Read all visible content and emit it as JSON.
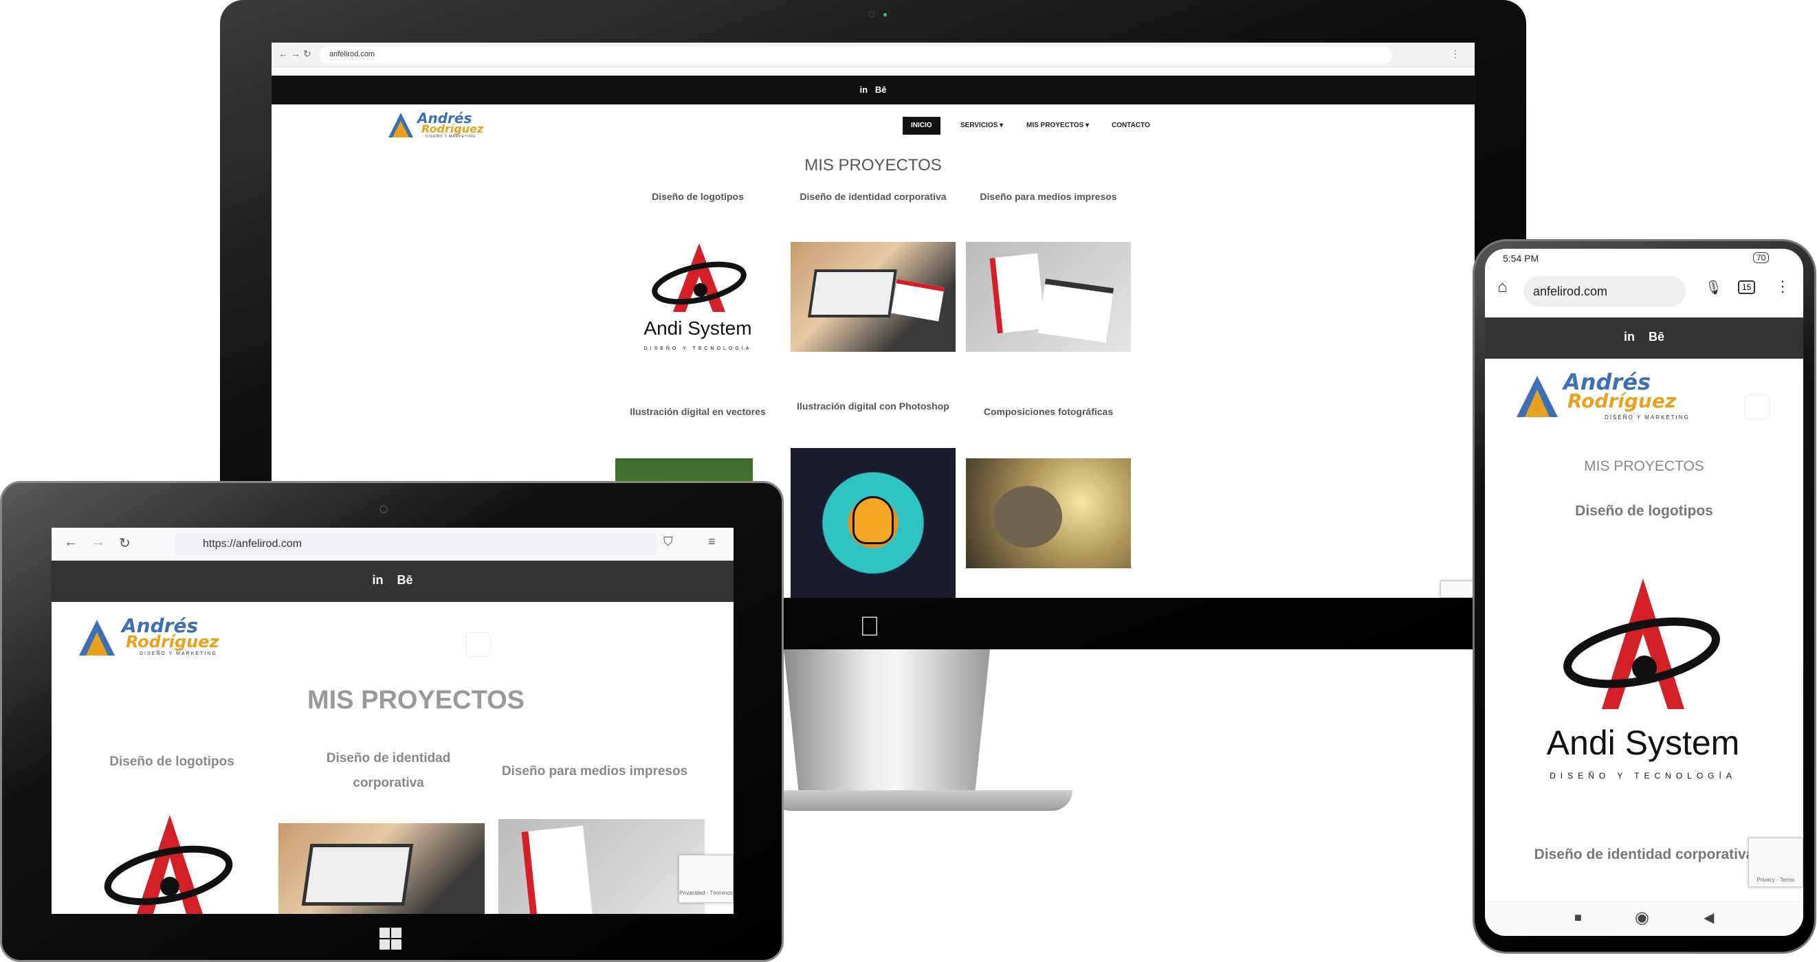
{
  "desktop": {
    "url": "anfelirod.com",
    "social": [
      "in",
      "Bē"
    ],
    "logo": {
      "line1": "Andrés",
      "line2": "Rodríguez",
      "tag": "DISEÑO Y MARKETING"
    },
    "menu": [
      "INICIO",
      "SERVICIOS ▾",
      "MIS PROYECTOS ▾",
      "CONTACTO"
    ],
    "title": "MIS PROYECTOS",
    "projects_row1": [
      "Diseño de logotipos",
      "Diseño de identidad corporativa",
      "Diseño para medios impresos"
    ],
    "projects_row2": [
      "Ilustración digital en vectores",
      "Ilustración digital con Photoshop",
      "Composiciones fotográficas"
    ],
    "andi": {
      "name": "Andi System",
      "tag": "DISEÑO Y TECNOLOGÍA"
    }
  },
  "tablet": {
    "url": "https://anfelirod.com",
    "social": [
      "in",
      "Bē"
    ],
    "logo": {
      "line1": "Andrés",
      "line2": "Rodríguez",
      "tag": "DISEÑO Y MARKETING"
    },
    "title": "MIS PROYECTOS",
    "projects": [
      "Diseño de logotipos",
      "Diseño de identidad corporativa",
      "Diseño para medios impresos"
    ],
    "recaptcha": "Privacidad - Términos"
  },
  "phone": {
    "time": "5:54 PM",
    "battery": "70",
    "tabs": "15",
    "url": "anfelirod.com",
    "social": [
      "in",
      "Bē"
    ],
    "logo": {
      "line1": "Andrés",
      "line2": "Rodríguez",
      "tag": "DISEÑO Y MARKETING"
    },
    "title": "MIS PROYECTOS",
    "project1": "Diseño de logotipos",
    "andi": {
      "name": "Andi System",
      "tag": "DISEÑO Y TECNOLOGÍA"
    },
    "project2": "Diseño de identidad corporativa",
    "recaptcha": "Privacy - Terms"
  },
  "colors": {
    "accent_red": "#d32027",
    "logo_blue": "#3b6fb6",
    "logo_orange": "#e8a21f",
    "dark_bar": "#333333"
  }
}
